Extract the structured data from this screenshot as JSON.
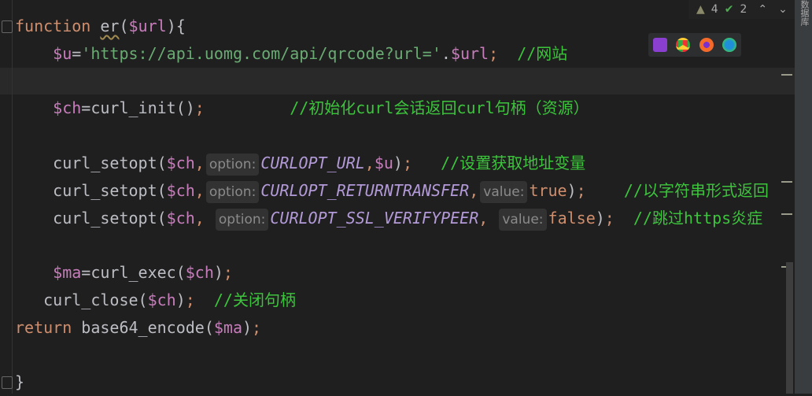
{
  "toolbar": {
    "warnings": "4",
    "checks": "2",
    "up": "⌃",
    "down": "⌄"
  },
  "side_label": "数据库",
  "browsers": [
    {
      "name": "phpstorm",
      "color": "#8b3fd1"
    },
    {
      "name": "chrome",
      "color": "#3c9a45"
    },
    {
      "name": "firefox",
      "color": "#f36a2a"
    },
    {
      "name": "edge",
      "color": "#1e8fd8"
    }
  ],
  "code": [
    [
      [
        "function ",
        "kw"
      ],
      [
        "er",
        "fn"
      ],
      [
        "(",
        "txt"
      ],
      [
        "$url",
        "var"
      ],
      [
        "){",
        "txt"
      ]
    ],
    [
      [
        "    ",
        ""
      ],
      [
        "$u",
        "var"
      ],
      [
        "=",
        "txt"
      ],
      [
        "'https://api.uomg.com/api/qrcode?url='",
        "str"
      ],
      [
        ".",
        "txt"
      ],
      [
        "$url",
        "var"
      ],
      [
        ";",
        "semi"
      ],
      [
        "  //网站",
        "cm"
      ]
    ],
    [],
    [
      [
        "    ",
        ""
      ],
      [
        "$ch",
        "var"
      ],
      [
        "=curl_init()",
        "txt"
      ],
      [
        ";",
        "semi"
      ],
      [
        "         //初始化curl会话返回curl句柄（资源）",
        "cm"
      ]
    ],
    [],
    [
      [
        "    curl_setopt(",
        ""
      ],
      [
        "$ch",
        "var"
      ],
      [
        ",",
        "semi"
      ],
      [
        "option:",
        "hint"
      ],
      [
        "CURLOPT_URL",
        "cst"
      ],
      [
        ",",
        "semi"
      ],
      [
        "$u",
        "var"
      ],
      [
        ")",
        "txt"
      ],
      [
        ";",
        "semi"
      ],
      [
        "   //设置获取地址变量",
        "cm"
      ]
    ],
    [
      [
        "    curl_setopt(",
        ""
      ],
      [
        "$ch",
        "var"
      ],
      [
        ",",
        "semi"
      ],
      [
        "option:",
        "hint"
      ],
      [
        "CURLOPT_RETURNTRANSFER",
        "cst"
      ],
      [
        ",",
        "semi"
      ],
      [
        "value:",
        "hint"
      ],
      [
        "true",
        "kw"
      ],
      [
        ")",
        "txt"
      ],
      [
        ";",
        "semi"
      ],
      [
        "    //以字符串形式返回",
        "cm"
      ]
    ],
    [
      [
        "    curl_setopt(",
        ""
      ],
      [
        "$ch",
        "var"
      ],
      [
        ", ",
        "semi"
      ],
      [
        "option:",
        "hint"
      ],
      [
        "CURLOPT_SSL_VERIFYPEER",
        "cst"
      ],
      [
        ", ",
        "semi"
      ],
      [
        "value:",
        "hint"
      ],
      [
        "false",
        "kw"
      ],
      [
        ")",
        "txt"
      ],
      [
        ";",
        "semi"
      ],
      [
        "  //跳过https炎症",
        "cm"
      ]
    ],
    [],
    [
      [
        "    ",
        ""
      ],
      [
        "$ma",
        "var"
      ],
      [
        "=curl_exec(",
        "txt"
      ],
      [
        "$ch",
        "var"
      ],
      [
        ")",
        "txt"
      ],
      [
        ";",
        "semi"
      ]
    ],
    [
      [
        "   curl_close(",
        ""
      ],
      [
        "$ch",
        "var"
      ],
      [
        ")",
        "txt"
      ],
      [
        ";",
        "semi"
      ],
      [
        "  //关闭句柄",
        "cm"
      ]
    ],
    [
      [
        "return ",
        "kw"
      ],
      [
        "base64_encode(",
        "txt"
      ],
      [
        "$ma",
        "var"
      ],
      [
        ")",
        "txt"
      ],
      [
        ";",
        "semi"
      ]
    ],
    [],
    [
      [
        "}",
        "txt"
      ]
    ]
  ]
}
